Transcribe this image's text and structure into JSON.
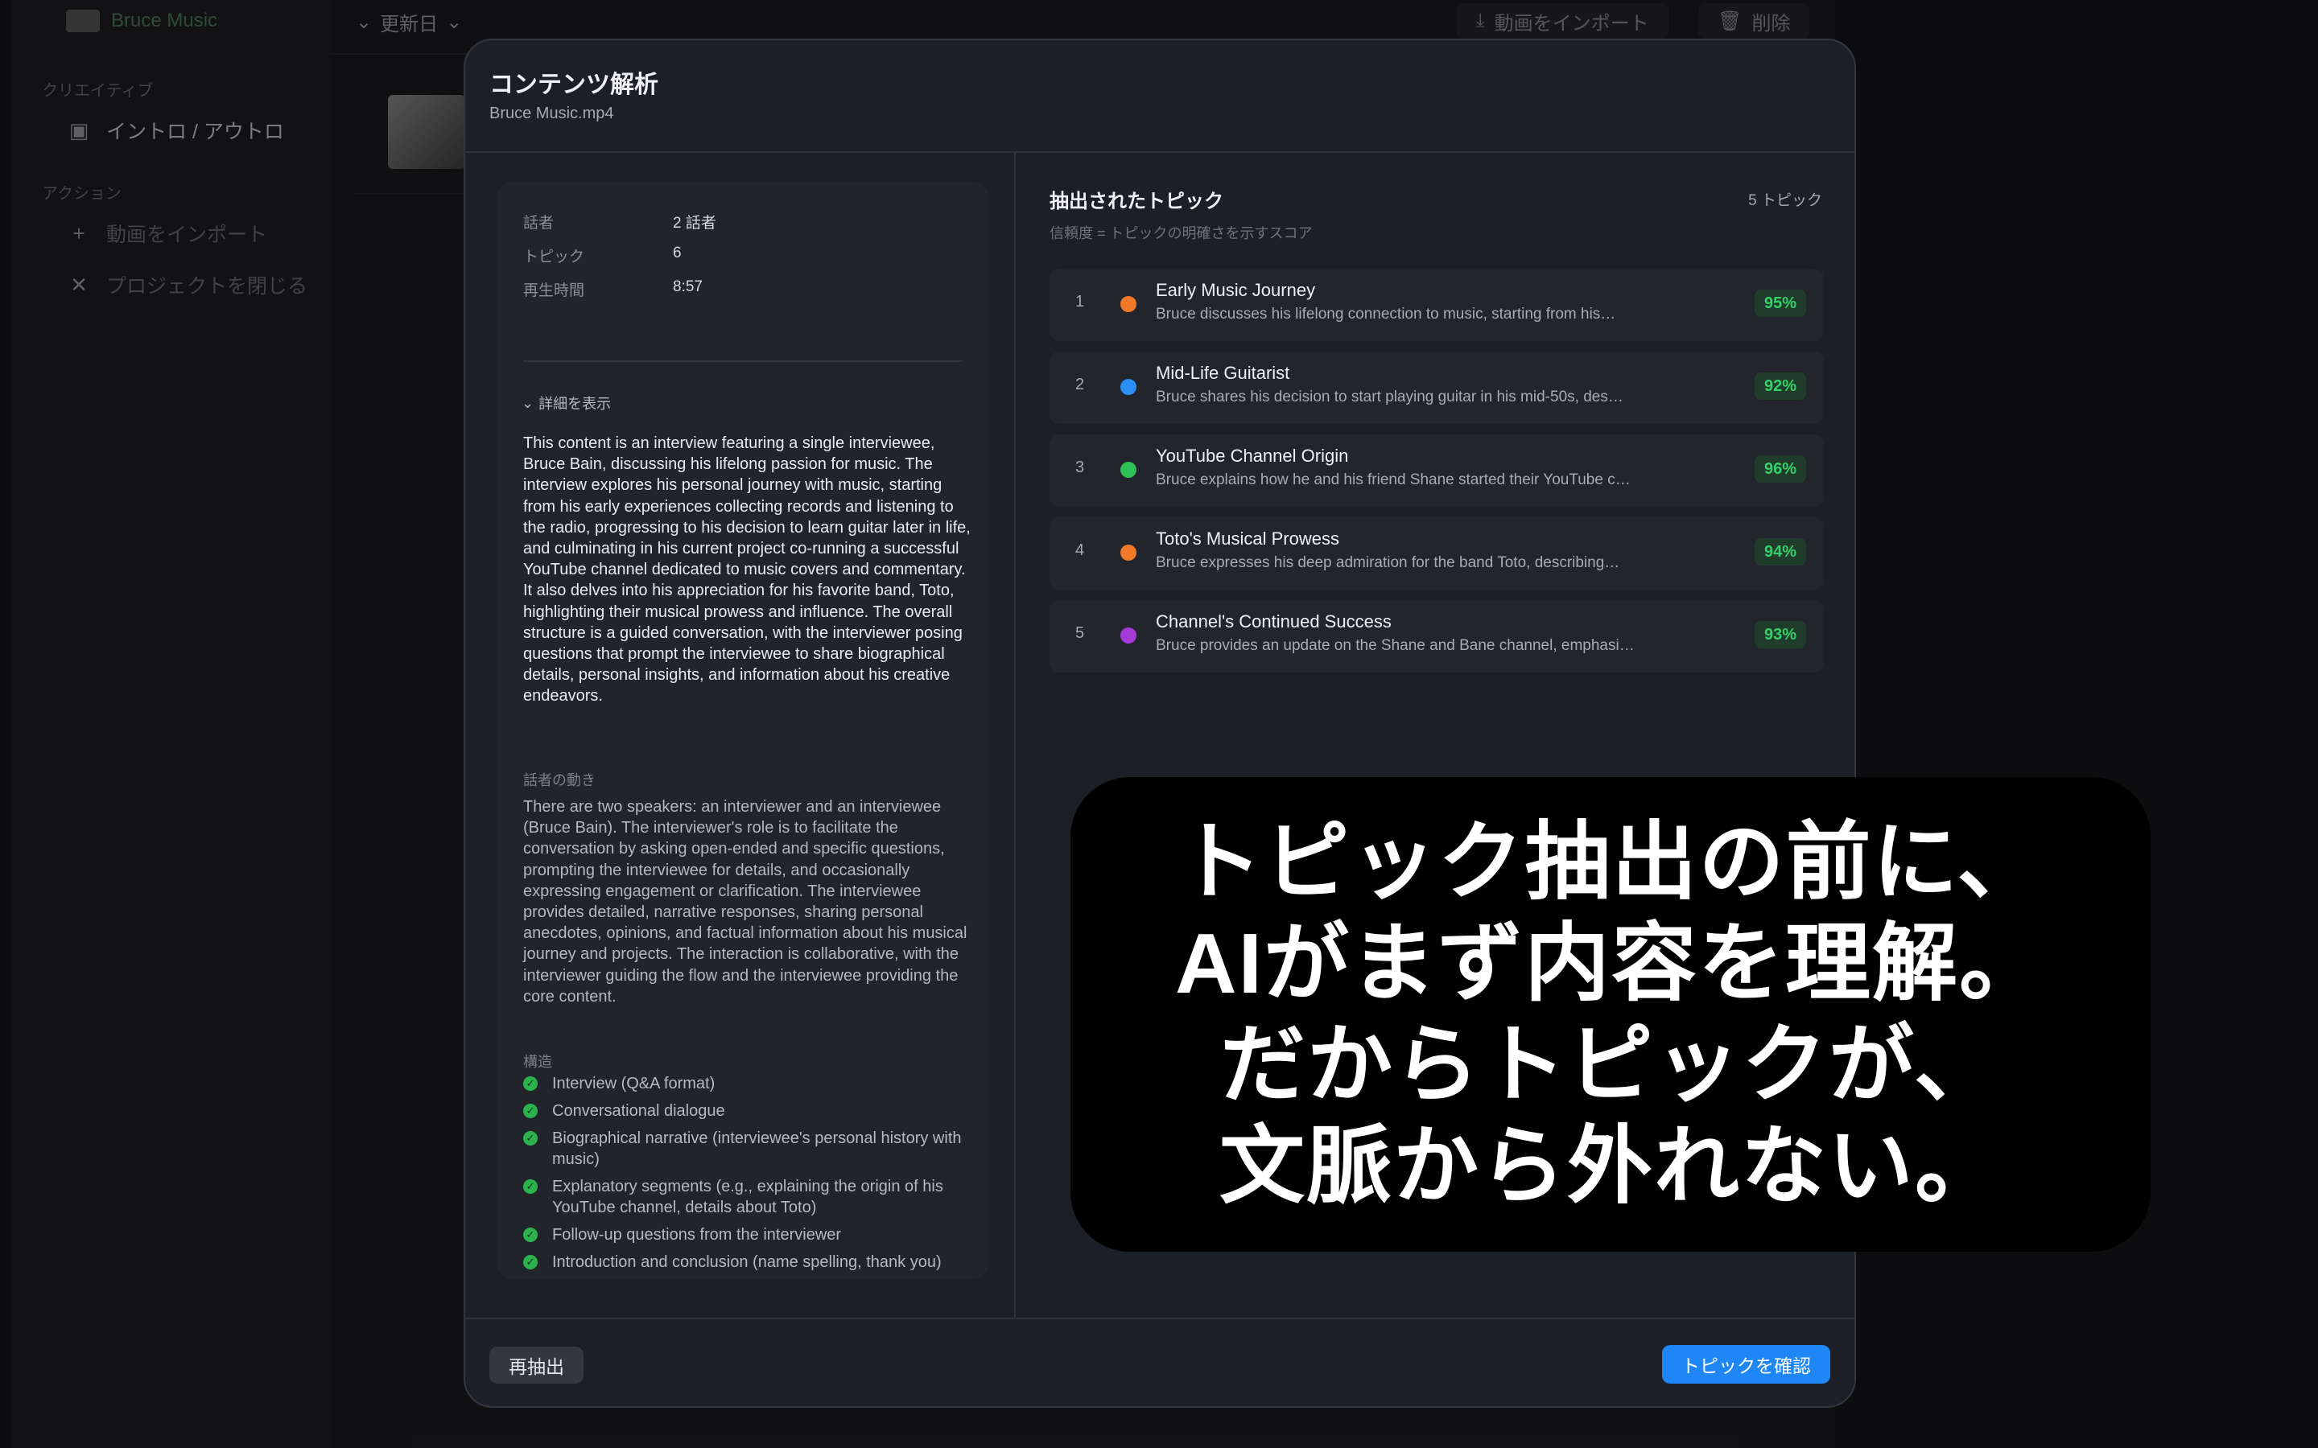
{
  "app": {
    "name": "Bruce Music",
    "sidebar": {
      "section_creative": "クリエイティブ",
      "intro_outro": "イントロ / アウトロ",
      "section_actions": "アクション",
      "import_video": "動画をインポート",
      "close_project": "プロジェクトを閉じる"
    },
    "toolbar": {
      "sort_label": "更新日",
      "import_button": "動画をインポート",
      "delete_button": "削除"
    }
  },
  "modal": {
    "title": "コンテンツ解析",
    "subtitle": "Bruce Music.mp4",
    "stats": [
      {
        "label": "話者",
        "value": "2 話者"
      },
      {
        "label": "トピック",
        "value": "6"
      },
      {
        "label": "再生時間",
        "value": "8:57"
      }
    ],
    "details_toggle": "詳細を表示",
    "summary": "This content is an interview featuring a single interviewee, Bruce Bain, discussing his lifelong passion for music. The interview explores his personal journey with music, starting from his early experiences collecting records and listening to the radio, progressing to his decision to learn guitar later in life, and culminating in his current project co-running a successful YouTube channel dedicated to music covers and commentary. It also delves into his appreciation for his favorite band, Toto, highlighting their musical prowess and influence. The overall structure is a guided conversation, with the interviewer posing questions that prompt the interviewee to share biographical details, personal insights, and information about his creative endeavors.",
    "speaker_dynamics_label": "話者の動き",
    "speaker_dynamics": "There are two speakers: an interviewer and an interviewee (Bruce Bain). The interviewer's role is to facilitate the conversation by asking open-ended and specific questions, prompting the interviewee for details, and occasionally expressing engagement or clarification. The interviewee provides detailed, narrative responses, sharing personal anecdotes, opinions, and factual information about his musical journey and projects. The interaction is collaborative, with the interviewer guiding the flow and the interviewee providing the core content.",
    "structure_label": "構造",
    "structure": [
      "Interview (Q&A format)",
      "Conversational dialogue",
      "Biographical narrative (interviewee's personal history with music)",
      "Explanatory segments (e.g., explaining the origin of his YouTube channel, details about Toto)",
      "Follow-up questions from the interviewer",
      "Introduction and conclusion (name spelling, thank you)"
    ],
    "topics_heading": "抽出されたトピック",
    "topics_count": "5 トピック",
    "topics_note": "信頼度 = トピックの明確さを示すスコア",
    "topics": [
      {
        "num": "1",
        "title": "Early Music Journey",
        "desc": "Bruce discusses his lifelong connection to music, starting from his…",
        "score": "95%",
        "color": "#f07a2a"
      },
      {
        "num": "2",
        "title": "Mid-Life Guitarist",
        "desc": "Bruce shares his decision to start playing guitar in his mid-50s, des…",
        "score": "92%",
        "color": "#2a8ff5"
      },
      {
        "num": "3",
        "title": "YouTube Channel Origin",
        "desc": "Bruce explains how he and his friend Shane started their YouTube c…",
        "score": "96%",
        "color": "#2fc05a"
      },
      {
        "num": "4",
        "title": "Toto's Musical Prowess",
        "desc": "Bruce expresses his deep admiration for the band Toto, describing…",
        "score": "94%",
        "color": "#f07a2a"
      },
      {
        "num": "5",
        "title": "Channel's Continued Success",
        "desc": "Bruce provides an update on the Shane and Bane channel, emphasi…",
        "score": "93%",
        "color": "#a53ad8"
      }
    ],
    "reextract_button": "再抽出",
    "confirm_button": "トピックを確認"
  },
  "caption": {
    "lines": [
      "トピック抽出の前に、",
      "AIがまず内容を理解。",
      "だからトピックが、",
      "文脈から外れない。"
    ]
  }
}
